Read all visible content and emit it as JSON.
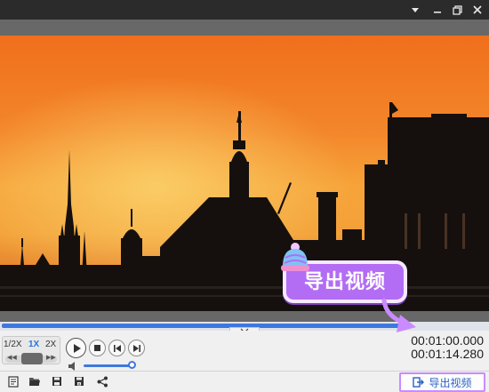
{
  "window": {
    "menu_icon": "dropdown-arrow-icon",
    "minimize_icon": "minimize-icon",
    "maximize_icon": "restore-icon",
    "close_icon": "close-icon"
  },
  "player": {
    "progress_fraction": 0.82,
    "speed": {
      "options": [
        "1/2X",
        "1X",
        "2X"
      ],
      "active": "1X",
      "prev_icon": "rewind-icon",
      "next_icon": "forward-icon"
    },
    "buttons": {
      "play": "play-icon",
      "stop": "stop-icon",
      "prev_frame": "prev-frame-icon",
      "next_frame": "next-frame-icon"
    },
    "volume_fraction": 0.95,
    "current_time": "00:01:00.000",
    "total_time": "00:01:14.280"
  },
  "toolbar": {
    "icons": [
      "new-project-icon",
      "open-folder-icon",
      "save-icon",
      "save-as-icon",
      "share-icon"
    ],
    "export_label": "导出视频"
  },
  "callout": {
    "label": "导出视频"
  },
  "colors": {
    "accent": "#3f78dd",
    "callout": "#b36cf4",
    "highlight_border": "#c98bff"
  }
}
